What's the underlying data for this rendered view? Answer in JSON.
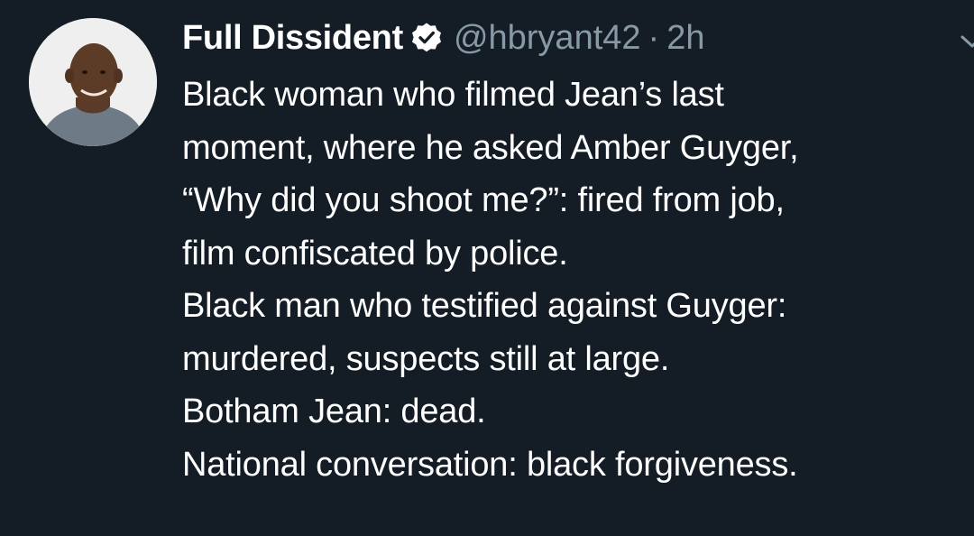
{
  "author": {
    "name": "Full Dissident",
    "handle": "@hbryant42",
    "separator": "·",
    "time": "2h",
    "verified": true,
    "avatar_icon": "profile-photo"
  },
  "tweet": {
    "lines": [
      "Black woman who filmed Jean’s last",
      "moment, where he asked Amber Guyger,",
      "“Why did you shoot me?”: fired from job,",
      "film confiscated by police.",
      "Black man who testified against Guyger:",
      "murdered, suspects still at large.",
      "Botham Jean: dead.",
      "National conversation: black forgiveness."
    ]
  },
  "icons": {
    "verified": "verified-badge-icon",
    "menu": "chevron-down-icon"
  },
  "colors": {
    "background": "#141d26",
    "text": "#ffffff",
    "muted": "#8899a6"
  }
}
